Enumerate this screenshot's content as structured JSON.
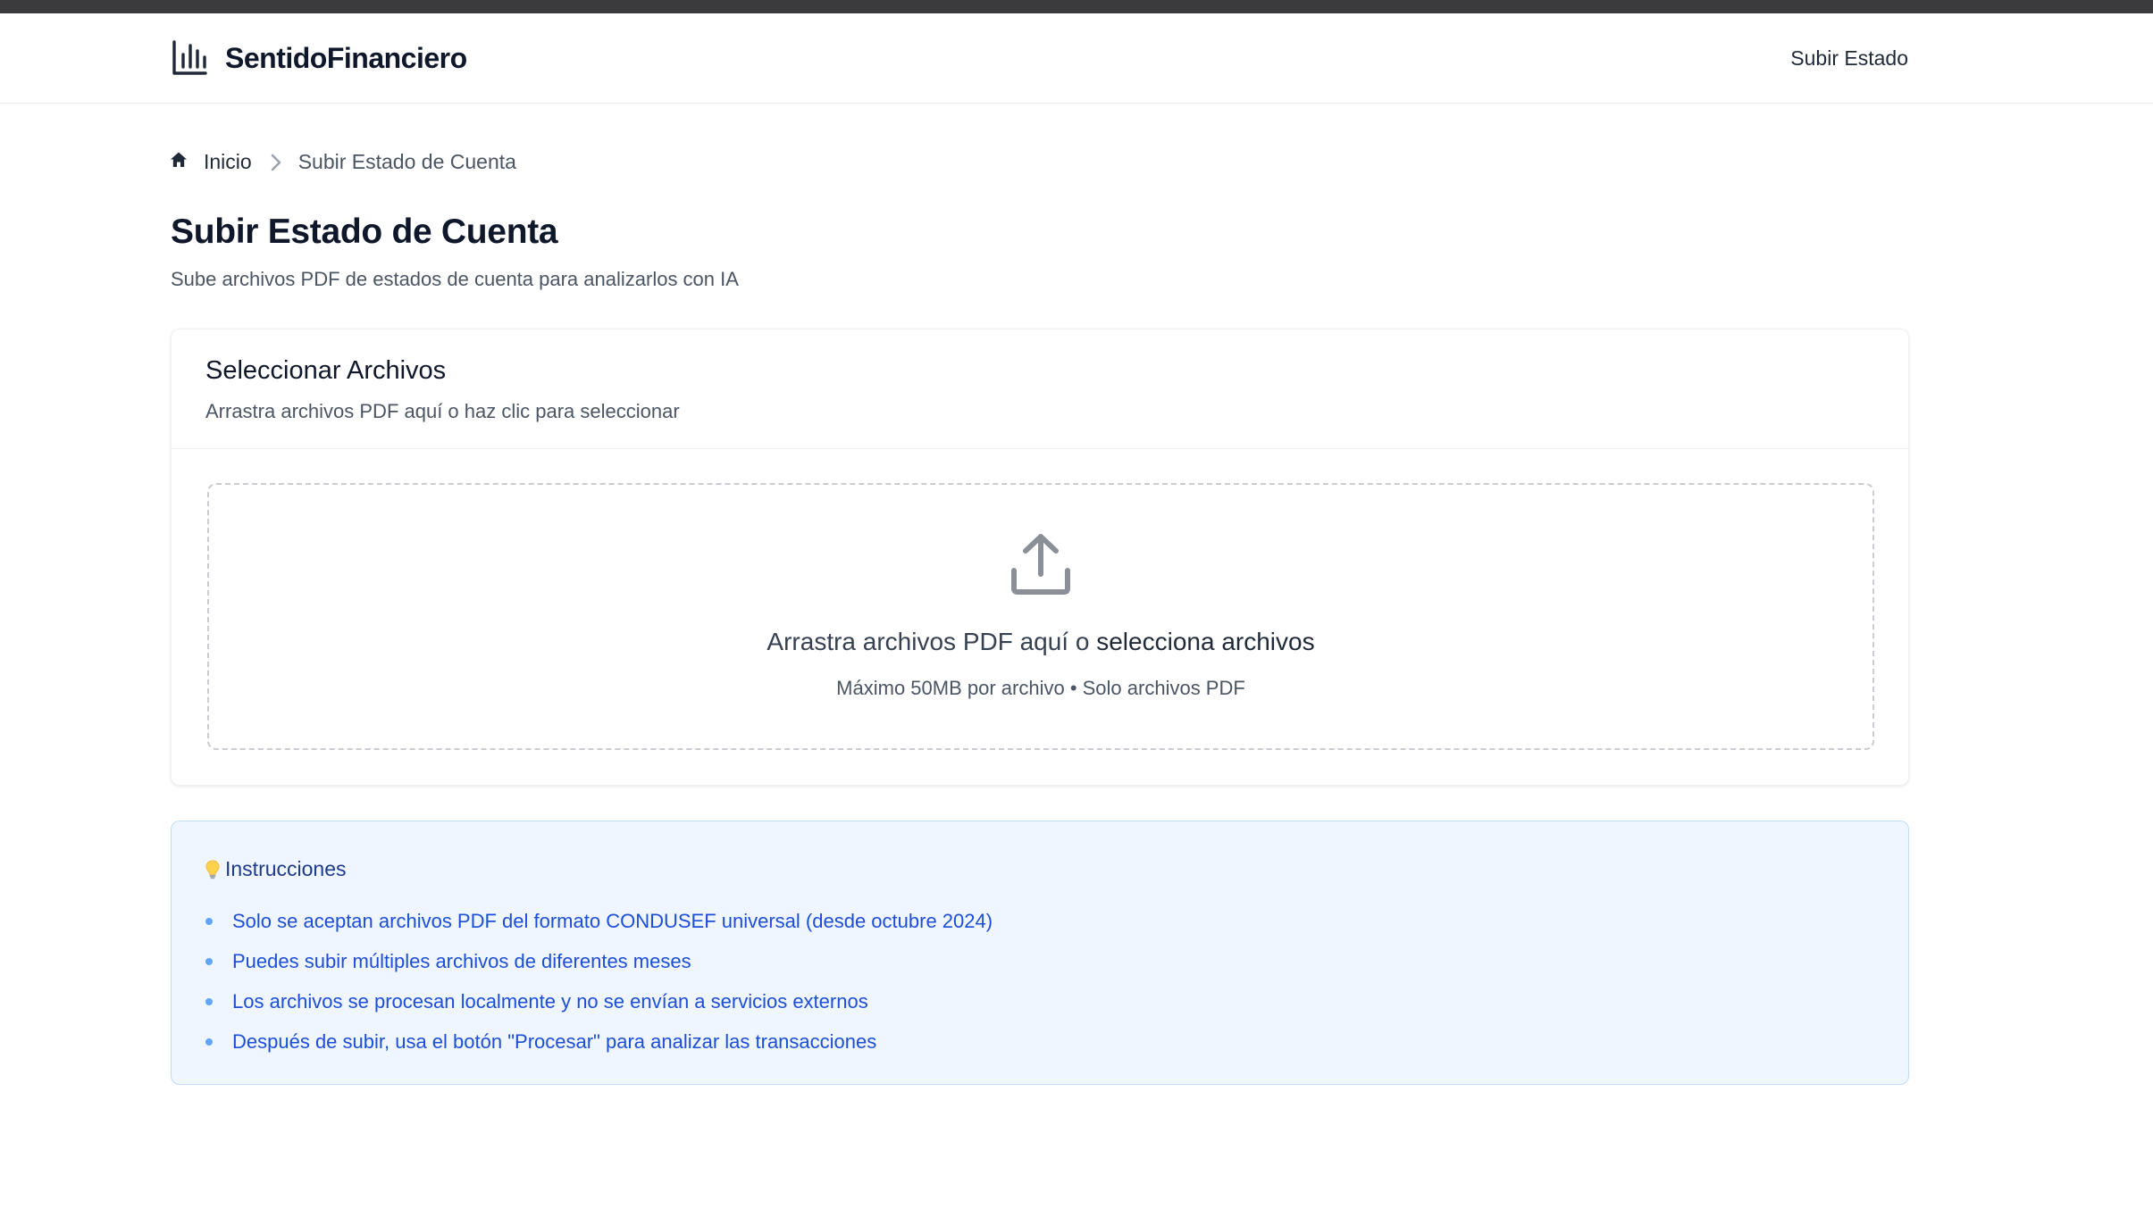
{
  "navbar": {
    "brand_icon": "bar-chart-icon",
    "brand_name": "SentidoFinanciero",
    "links": [
      {
        "label": "Subir Estado"
      }
    ]
  },
  "breadcrumb": {
    "home_icon": "home-icon",
    "home_label": "Inicio",
    "separator_icon": "chevron-right-icon",
    "current_label": "Subir Estado de Cuenta"
  },
  "page": {
    "title": "Subir Estado de Cuenta",
    "subtitle": "Sube archivos PDF de estados de cuenta para analizarlos con IA"
  },
  "upload_card": {
    "title": "Seleccionar Archivos",
    "description": "Arrastra archivos PDF aquí o haz clic para seleccionar",
    "dropzone": {
      "icon": "upload-icon",
      "main_text": "Arrastra archivos PDF aquí o ",
      "select_link": "selecciona archivos",
      "hint": "Máximo 50MB por archivo • Solo archivos PDF"
    }
  },
  "instructions": {
    "icon": "lightbulb-icon",
    "title": "Instrucciones",
    "items": [
      "Solo se aceptan archivos PDF del formato CONDUSEF universal (desde octubre 2024)",
      "Puedes subir múltiples archivos de diferentes meses",
      "Los archivos se procesan localmente y no se envían a servicios externos",
      "Después de subir, usa el botón \"Procesar\" para analizar las transacciones"
    ]
  },
  "colors": {
    "instructions_bg": "#eff6ff",
    "instructions_border": "#bfdbfe",
    "instructions_text": "#1d4ed8",
    "instructions_title": "#1e3a8a",
    "bullet": "#60a5fa"
  }
}
